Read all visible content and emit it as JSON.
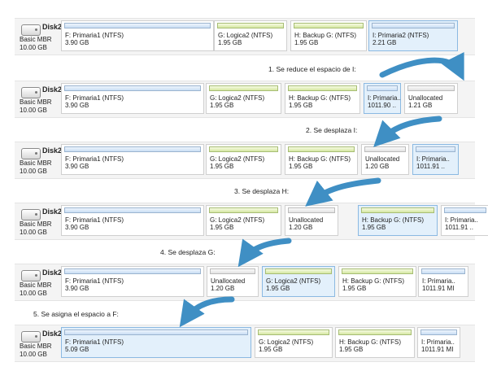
{
  "disk": {
    "name": "Disk2",
    "type": "Basic MBR",
    "size": "10.00 GB"
  },
  "rows": [
    {
      "parts": [
        {
          "name": "F: Primaria1 (NTFS)",
          "size": "3.90 GB",
          "kind": "primary",
          "selected": false
        },
        {
          "name": "G: Logica2 (NTFS)",
          "size": "1.95 GB",
          "kind": "logical",
          "selected": false
        },
        {
          "name": "H: Backup G: (NTFS)",
          "size": "1.95 GB",
          "kind": "logical",
          "selected": false
        },
        {
          "name": "I: Primaria2 (NTFS)",
          "size": "2.21 GB",
          "kind": "primary",
          "selected": true
        }
      ]
    },
    {
      "parts": [
        {
          "name": "F: Primaria1 (NTFS)",
          "size": "3.90 GB",
          "kind": "primary",
          "selected": false
        },
        {
          "name": "G: Logica2 (NTFS)",
          "size": "1.95 GB",
          "kind": "logical",
          "selected": false
        },
        {
          "name": "H: Backup G: (NTFS)",
          "size": "1.95 GB",
          "kind": "logical",
          "selected": false
        },
        {
          "name": "I: Primaria..",
          "size": "1011.90 ..",
          "kind": "primary",
          "selected": true
        },
        {
          "name": "Unallocated",
          "size": "1.21 GB",
          "kind": "unalloc",
          "selected": false
        }
      ]
    },
    {
      "parts": [
        {
          "name": "F: Primaria1 (NTFS)",
          "size": "3.90 GB",
          "kind": "primary",
          "selected": false
        },
        {
          "name": "G: Logica2 (NTFS)",
          "size": "1.95 GB",
          "kind": "logical",
          "selected": false
        },
        {
          "name": "H: Backup G: (NTFS)",
          "size": "1.95 GB",
          "kind": "logical",
          "selected": false
        },
        {
          "name": "Unallocated",
          "size": "1.20 GB",
          "kind": "unalloc",
          "selected": false
        },
        {
          "name": "I: Primaria..",
          "size": "1011.91 ..",
          "kind": "primary",
          "selected": true
        }
      ]
    },
    {
      "parts": [
        {
          "name": "F: Primaria1 (NTFS)",
          "size": "3.90 GB",
          "kind": "primary",
          "selected": false
        },
        {
          "name": "G: Logica2 (NTFS)",
          "size": "1.95 GB",
          "kind": "logical",
          "selected": false
        },
        {
          "name": "Unallocated",
          "size": "1.20 GB",
          "kind": "unalloc",
          "selected": false
        },
        {
          "name": "H: Backup G: (NTFS)",
          "size": "1.95 GB",
          "kind": "logical",
          "selected": true
        },
        {
          "name": "I: Primaria..",
          "size": "1011.91 ..",
          "kind": "primary",
          "selected": false
        }
      ]
    },
    {
      "parts": [
        {
          "name": "F: Primaria1 (NTFS)",
          "size": "3.90 GB",
          "kind": "primary",
          "selected": false
        },
        {
          "name": "Unallocated",
          "size": "1.20 GB",
          "kind": "unalloc",
          "selected": false
        },
        {
          "name": "G: Logica2 (NTFS)",
          "size": "1.95 GB",
          "kind": "logical",
          "selected": true
        },
        {
          "name": "H: Backup G: (NTFS)",
          "size": "1.95 GB",
          "kind": "logical",
          "selected": false
        },
        {
          "name": "I: Primaria..",
          "size": "1011.91 MI",
          "kind": "primary",
          "selected": false
        }
      ]
    },
    {
      "parts": [
        {
          "name": "F: Primaria1 (NTFS)",
          "size": "5.09 GB",
          "kind": "primary",
          "selected": true
        },
        {
          "name": "G: Logica2 (NTFS)",
          "size": "1.95 GB",
          "kind": "logical",
          "selected": false
        },
        {
          "name": "H: Backup G: (NTFS)",
          "size": "1.95 GB",
          "kind": "logical",
          "selected": false
        },
        {
          "name": "I: Primaria..",
          "size": "1011.91 MI",
          "kind": "primary",
          "selected": false
        }
      ]
    }
  ],
  "steps": [
    "1. Se reduce el espacio de I:",
    "2. Se desplaza I:",
    "3. Se desplaza H:",
    "4. Se desplaza G:",
    "5. Se asigna el espacio a F:"
  ],
  "colors": {
    "arrow": "#3f8fc4",
    "selected_bg": "#e3f0fb"
  }
}
